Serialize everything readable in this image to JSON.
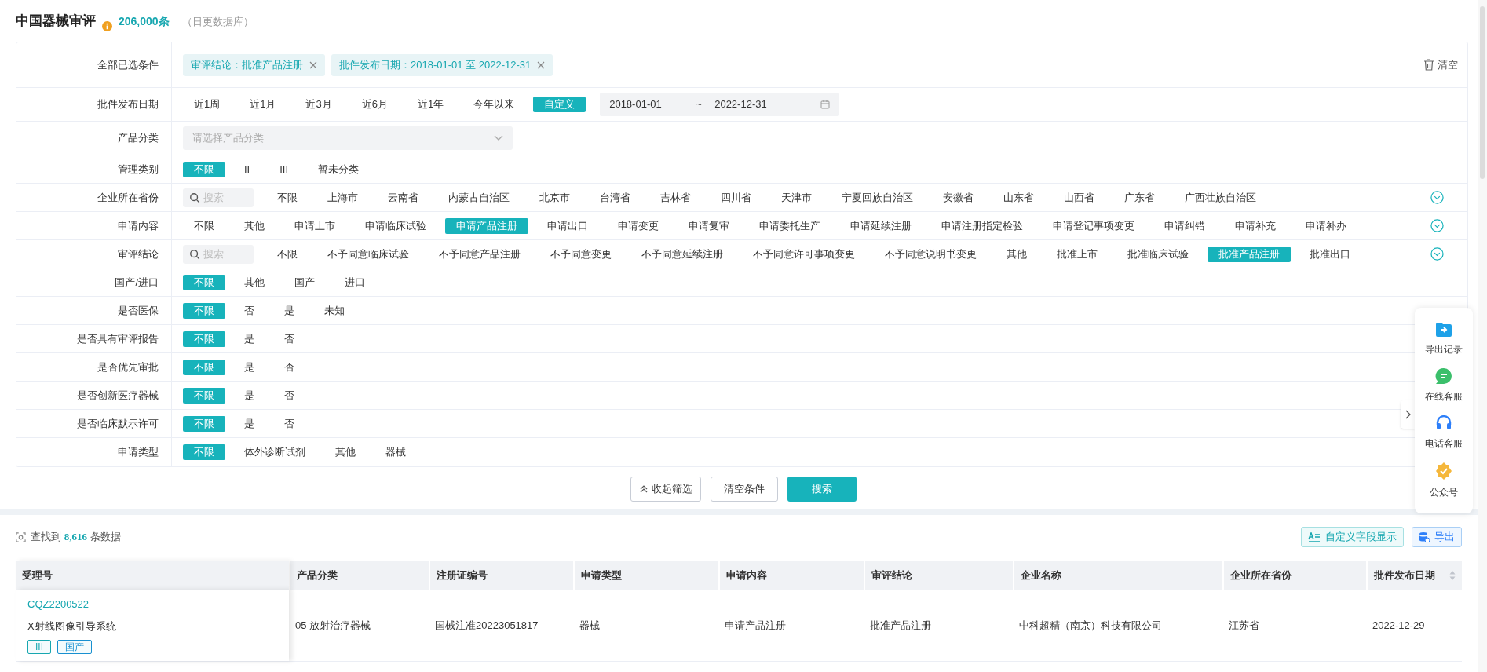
{
  "header": {
    "title": "中国器械审评",
    "count": "206,000条",
    "note": "（日更数据库）"
  },
  "conditions": {
    "label": "全部已选条件",
    "chips": [
      {
        "text": "审评结论：批准产品注册"
      },
      {
        "text": "批件发布日期：2018-01-01 至 2022-12-31"
      }
    ],
    "clear": "清空"
  },
  "filter_rows": [
    {
      "label": "批件发布日期",
      "kind": "date",
      "options": [
        {
          "label": "近1周",
          "selected": false
        },
        {
          "label": "近1月",
          "selected": false
        },
        {
          "label": "近3月",
          "selected": false
        },
        {
          "label": "近6月",
          "selected": false
        },
        {
          "label": "近1年",
          "selected": false
        },
        {
          "label": "今年以来",
          "selected": false
        },
        {
          "label": "自定义",
          "selected": true
        }
      ],
      "range": {
        "start": "2018-01-01",
        "separator": "~",
        "end": "2022-12-31"
      }
    },
    {
      "label": "产品分类",
      "kind": "select",
      "placeholder": "请选择产品分类"
    },
    {
      "label": "管理类别",
      "kind": "options",
      "expandable": false,
      "options": [
        {
          "label": "不限",
          "selected": true
        },
        {
          "label": "II",
          "selected": false
        },
        {
          "label": "III",
          "selected": false
        },
        {
          "label": "暂未分类",
          "selected": false
        }
      ]
    },
    {
      "label": "企业所在省份",
      "kind": "options",
      "search": "搜索",
      "expandable": true,
      "options": [
        {
          "label": "不限",
          "selected": false
        },
        {
          "label": "上海市",
          "selected": false
        },
        {
          "label": "云南省",
          "selected": false
        },
        {
          "label": "内蒙古自治区",
          "selected": false
        },
        {
          "label": "北京市",
          "selected": false
        },
        {
          "label": "台湾省",
          "selected": false
        },
        {
          "label": "吉林省",
          "selected": false
        },
        {
          "label": "四川省",
          "selected": false
        },
        {
          "label": "天津市",
          "selected": false
        },
        {
          "label": "宁夏回族自治区",
          "selected": false
        },
        {
          "label": "安徽省",
          "selected": false
        },
        {
          "label": "山东省",
          "selected": false
        },
        {
          "label": "山西省",
          "selected": false
        },
        {
          "label": "广东省",
          "selected": false
        },
        {
          "label": "广西壮族自治区",
          "selected": false
        }
      ]
    },
    {
      "label": "申请内容",
      "kind": "options",
      "expandable": true,
      "options": [
        {
          "label": "不限",
          "selected": false
        },
        {
          "label": "其他",
          "selected": false
        },
        {
          "label": "申请上市",
          "selected": false
        },
        {
          "label": "申请临床试验",
          "selected": false
        },
        {
          "label": "申请产品注册",
          "selected": true
        },
        {
          "label": "申请出口",
          "selected": false
        },
        {
          "label": "申请变更",
          "selected": false
        },
        {
          "label": "申请复审",
          "selected": false
        },
        {
          "label": "申请委托生产",
          "selected": false
        },
        {
          "label": "申请延续注册",
          "selected": false
        },
        {
          "label": "申请注册指定检验",
          "selected": false
        },
        {
          "label": "申请登记事项变更",
          "selected": false
        },
        {
          "label": "申请纠错",
          "selected": false
        },
        {
          "label": "申请补充",
          "selected": false
        },
        {
          "label": "申请补办",
          "selected": false
        }
      ]
    },
    {
      "label": "审评结论",
      "kind": "options",
      "search": "搜索",
      "expandable": true,
      "options": [
        {
          "label": "不限",
          "selected": false
        },
        {
          "label": "不予同意临床试验",
          "selected": false
        },
        {
          "label": "不予同意产品注册",
          "selected": false
        },
        {
          "label": "不予同意变更",
          "selected": false
        },
        {
          "label": "不予同意延续注册",
          "selected": false
        },
        {
          "label": "不予同意许可事项变更",
          "selected": false
        },
        {
          "label": "不予同意说明书变更",
          "selected": false
        },
        {
          "label": "其他",
          "selected": false
        },
        {
          "label": "批准上市",
          "selected": false
        },
        {
          "label": "批准临床试验",
          "selected": false
        },
        {
          "label": "批准产品注册",
          "selected": true
        },
        {
          "label": "批准出口",
          "selected": false
        }
      ]
    },
    {
      "label": "国产/进口",
      "kind": "options",
      "expandable": false,
      "options": [
        {
          "label": "不限",
          "selected": true
        },
        {
          "label": "其他",
          "selected": false
        },
        {
          "label": "国产",
          "selected": false
        },
        {
          "label": "进口",
          "selected": false
        }
      ]
    },
    {
      "label": "是否医保",
      "kind": "options",
      "expandable": false,
      "options": [
        {
          "label": "不限",
          "selected": true
        },
        {
          "label": "否",
          "selected": false
        },
        {
          "label": "是",
          "selected": false
        },
        {
          "label": "未知",
          "selected": false
        }
      ]
    },
    {
      "label": "是否具有审评报告",
      "kind": "options",
      "expandable": false,
      "options": [
        {
          "label": "不限",
          "selected": true
        },
        {
          "label": "是",
          "selected": false
        },
        {
          "label": "否",
          "selected": false
        }
      ]
    },
    {
      "label": "是否优先审批",
      "kind": "options",
      "expandable": false,
      "options": [
        {
          "label": "不限",
          "selected": true
        },
        {
          "label": "是",
          "selected": false
        },
        {
          "label": "否",
          "selected": false
        }
      ]
    },
    {
      "label": "是否创新医疗器械",
      "kind": "options",
      "expandable": false,
      "options": [
        {
          "label": "不限",
          "selected": true
        },
        {
          "label": "是",
          "selected": false
        },
        {
          "label": "否",
          "selected": false
        }
      ]
    },
    {
      "label": "是否临床默示许可",
      "kind": "options",
      "expandable": false,
      "options": [
        {
          "label": "不限",
          "selected": true
        },
        {
          "label": "是",
          "selected": false
        },
        {
          "label": "否",
          "selected": false
        }
      ]
    },
    {
      "label": "申请类型",
      "kind": "options",
      "expandable": false,
      "options": [
        {
          "label": "不限",
          "selected": true
        },
        {
          "label": "体外诊断试剂",
          "selected": false
        },
        {
          "label": "其他",
          "selected": false
        },
        {
          "label": "器械",
          "selected": false
        }
      ]
    }
  ],
  "actions": [
    {
      "label": "收起筛选",
      "kind": "collapse"
    },
    {
      "label": "清空条件",
      "kind": "plain"
    },
    {
      "label": "搜索",
      "kind": "primary"
    }
  ],
  "results": {
    "prefix": "查找到",
    "count": "8,616",
    "suffix": "条数据",
    "buttons": [
      {
        "label": "自定义字段显示",
        "kind": "customize"
      },
      {
        "label": "导出",
        "kind": "export"
      }
    ]
  },
  "table": {
    "columns": [
      {
        "label": "受理号",
        "sortable": false
      },
      {
        "label": "产品分类",
        "sortable": false
      },
      {
        "label": "注册证编号",
        "sortable": false
      },
      {
        "label": "申请类型",
        "sortable": false
      },
      {
        "label": "申请内容",
        "sortable": false
      },
      {
        "label": "审评结论",
        "sortable": false
      },
      {
        "label": "企业名称",
        "sortable": false
      },
      {
        "label": "企业所在省份",
        "sortable": false
      },
      {
        "label": "批件发布日期",
        "sortable": true
      }
    ],
    "rows": [
      {
        "cells": [
          {
            "id": "CQZ2200522",
            "name": "X射线图像引导系统",
            "tags": [
              {
                "text": "III",
                "color": "#17a7b0"
              },
              {
                "text": "国产",
                "color": "#1890d0"
              }
            ]
          },
          "05 放射治疗器械",
          "国械注准20223051817",
          "器械",
          "申请产品注册",
          "批准产品注册",
          "中科超精（南京）科技有限公司",
          "江苏省",
          "2022-12-29"
        ]
      }
    ]
  },
  "side_panel": [
    {
      "label": "导出记录",
      "kind": "export"
    },
    {
      "label": "在线客服",
      "kind": "chat"
    },
    {
      "label": "电话客服",
      "kind": "phone"
    },
    {
      "label": "公众号",
      "kind": "account"
    }
  ]
}
